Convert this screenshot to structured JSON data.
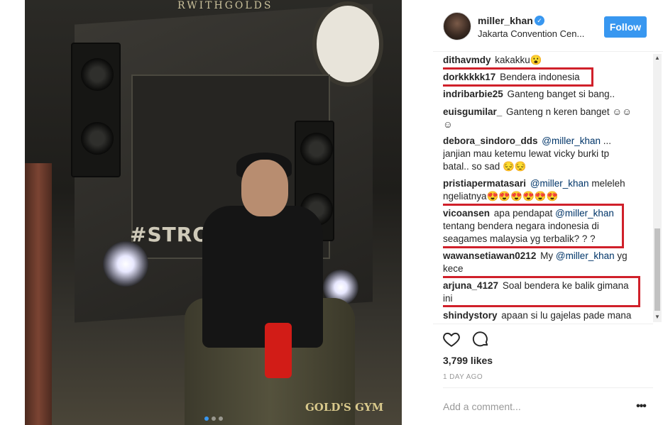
{
  "photo": {
    "hashtag": "#STRON",
    "brand_bottom": "GOLD'S GYM",
    "brand_top": "RWITHGOLDS",
    "carousel_dots": 3,
    "active_dot": 1
  },
  "header": {
    "username": "miller_khan",
    "verified": true,
    "location": "Jakarta Convention Cen...",
    "follow_label": "Follow",
    "accent_color": "#3897f0"
  },
  "comments": [
    {
      "user": "dithavmdy",
      "text": "kakakku😮"
    },
    {
      "user": "dorkkkkk17",
      "text": "Bendera indonesia",
      "highlighted": true
    },
    {
      "user": "indribarbie25",
      "text": "Ganteng banget si bang.."
    },
    {
      "user": "euisgumilar_",
      "text": "Ganteng n keren banget ☺☺",
      "text2": "☺"
    },
    {
      "user": "debora_sindoro_dds",
      "mention": "@miller_khan",
      "text": "...",
      "text2": "janjian mau ketemu lewat vicky burki tp",
      "text3": "batal.. so sad 😔😔"
    },
    {
      "user": "pristiapermatasari",
      "mention": "@miller_khan",
      "text": "meleleh",
      "text2": "ngeliatnya😍😍😍😍😍😍"
    },
    {
      "user": "vicoansen",
      "text": "apa pendapat",
      "mention": "@miller_khan",
      "text2": "tentang bendera negara indonesia di",
      "text3": "seagames malaysia yg terbalik? ? ?",
      "highlighted": true
    },
    {
      "user": "wawansetiawan0212",
      "text": "My",
      "mention": "@miller_khan",
      "text_after": "yg",
      "text2": "kece"
    },
    {
      "user": "arjuna_4127",
      "text": "Soal bendera ke balik gimana",
      "text2": "ini",
      "highlighted": true
    },
    {
      "user": "shindystory",
      "text": "apaan si lu gajelas pade mana"
    }
  ],
  "actions": {
    "like_icon": "heart-icon",
    "comment_icon": "comment-bubble-icon"
  },
  "likes_text": "3,799 likes",
  "time_ago": "1 DAY AGO",
  "comment_placeholder": "Add a comment...",
  "more_label": "•••",
  "highlight_color": "#d0202a"
}
